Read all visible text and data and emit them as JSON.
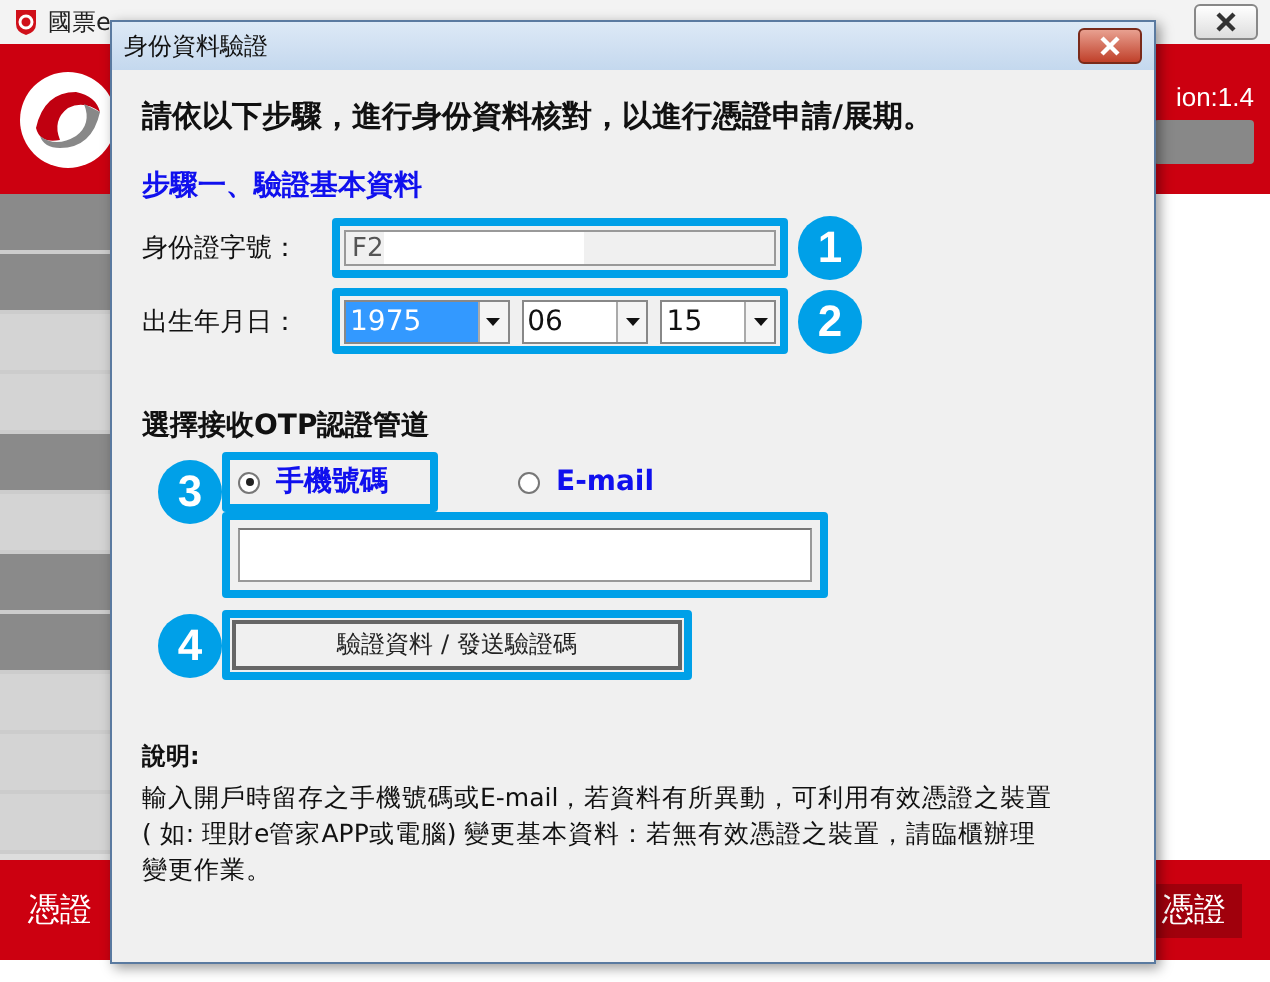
{
  "app": {
    "title": "國票e",
    "version": "ion:1.4",
    "footer_left": "憑證",
    "footer_right": "憑證"
  },
  "dialog": {
    "title": "身份資料驗證",
    "instruction": "請依以下步驟，進行身份資料核對，以進行憑證申請/展期。",
    "step_title": "步驟一、驗證基本資料",
    "id_field": {
      "label": "身份證字號：",
      "value": "F2",
      "badge": "1"
    },
    "birth_date": {
      "label": "出生年月日：",
      "badge": "2",
      "selects": [
        {
          "value": "1975",
          "selected": true
        },
        {
          "value": "06",
          "selected": false
        },
        {
          "value": "15",
          "selected": false
        }
      ]
    },
    "otp": {
      "title": "選擇接收OTP認證管道",
      "badge": "3",
      "options": [
        {
          "label": "手機號碼",
          "selected": true
        },
        {
          "label": "E-mail",
          "selected": false
        }
      ]
    },
    "submit": {
      "label": "驗證資料 / 發送驗證碼",
      "badge": "4"
    },
    "notes": {
      "title": "說明:",
      "text": "輸入開戶時留存之手機號碼或E-mail，若資料有所異動，可利用有效憑證之裝置( 如: 理財e管家APP或電腦) 變更基本資料：若無有效憑證之裝置，請臨櫃辦理變更作業。"
    }
  }
}
